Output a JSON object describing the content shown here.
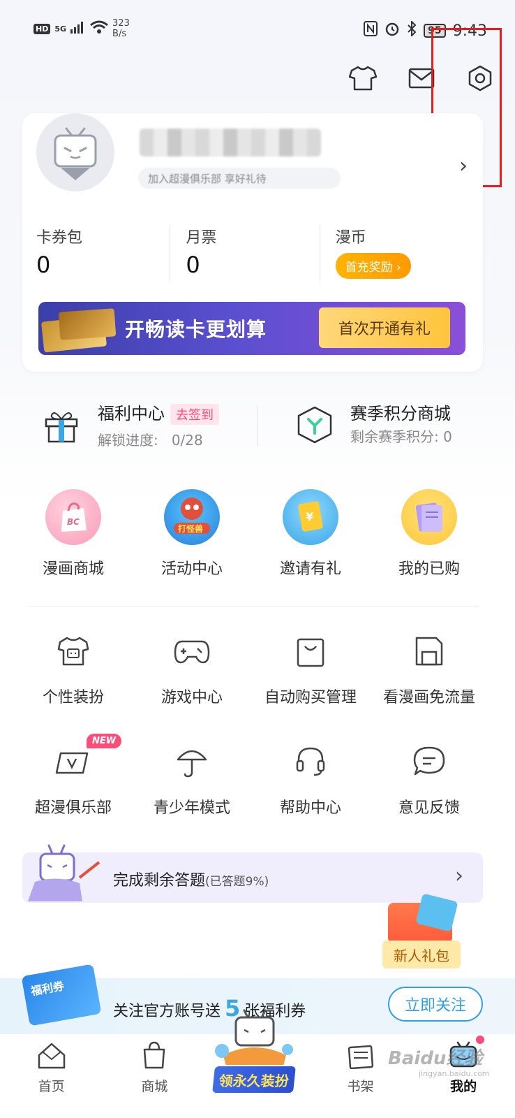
{
  "status_bar": {
    "hd": "HD",
    "network": "5G",
    "speed_value": "323",
    "speed_unit": "B/s",
    "battery": "95",
    "time": "9:43"
  },
  "profile": {
    "subtitle": "加入超漫俱乐部 享好礼待",
    "stats": [
      {
        "label": "卡券包",
        "value": "0"
      },
      {
        "label": "月票",
        "value": "0"
      },
      {
        "label": "漫币",
        "reward": "首充奖励 ›"
      }
    ],
    "vip_banner": {
      "text": "开畅读卡更划算",
      "cta": "首次开通有礼"
    }
  },
  "welfare": {
    "left": {
      "title": "福利中心",
      "badge": "去签到",
      "progress_label": "解锁进度:",
      "progress_value": "0/28"
    },
    "right": {
      "title": "赛季积分商城",
      "sub": "剩余赛季积分: 0"
    }
  },
  "grid_main": [
    {
      "label": "漫画商城",
      "icon": "shopping-bag-icon",
      "color": "#f7a4bf"
    },
    {
      "label": "活动中心",
      "icon": "octopus-event-icon",
      "color": "#3aa1e6"
    },
    {
      "label": "邀请有礼",
      "icon": "invite-coupon-icon",
      "color": "#ffcc33"
    },
    {
      "label": "我的已购",
      "icon": "purchased-books-icon",
      "color": "#a58cf0"
    }
  ],
  "grid_tools_1": [
    {
      "label": "个性装扮",
      "icon": "tshirt-icon"
    },
    {
      "label": "游戏中心",
      "icon": "gamepad-icon"
    },
    {
      "label": "自动购买管理",
      "icon": "bag-icon"
    },
    {
      "label": "看漫画免流量",
      "icon": "sim-card-icon"
    }
  ],
  "grid_tools_2": [
    {
      "label": "超漫俱乐部",
      "icon": "vip-card-icon",
      "badge": "NEW"
    },
    {
      "label": "青少年模式",
      "icon": "umbrella-icon"
    },
    {
      "label": "帮助中心",
      "icon": "headset-icon"
    },
    {
      "label": "意见反馈",
      "icon": "chat-bubble-icon"
    }
  ],
  "quiz": {
    "text": "完成剩余答题",
    "progress": "(已答题9%)"
  },
  "gift": {
    "label": "新人礼包"
  },
  "follow": {
    "prefix": "关注官方账号送",
    "count": "5",
    "suffix": "张福利券",
    "button": "立即关注",
    "ticket_label": "福利券"
  },
  "promo": {
    "label": "领永久装扮"
  },
  "bottom_nav": [
    {
      "label": "首页",
      "icon": "home-icon"
    },
    {
      "label": "商城",
      "icon": "shop-bag-icon"
    },
    {
      "label": "",
      "icon": "center-promo"
    },
    {
      "label": "书架",
      "icon": "bookshelf-icon"
    },
    {
      "label": "我的",
      "icon": "profile-tv-icon"
    }
  ],
  "watermark": {
    "text": "Baidu经验",
    "sub": "jingyan.baidu.com"
  },
  "colors": {
    "accent_pink": "#ff4d79",
    "accent_blue": "#2ea0e6",
    "reward_orange": "#ffa500",
    "highlight_red": "#e02020"
  }
}
